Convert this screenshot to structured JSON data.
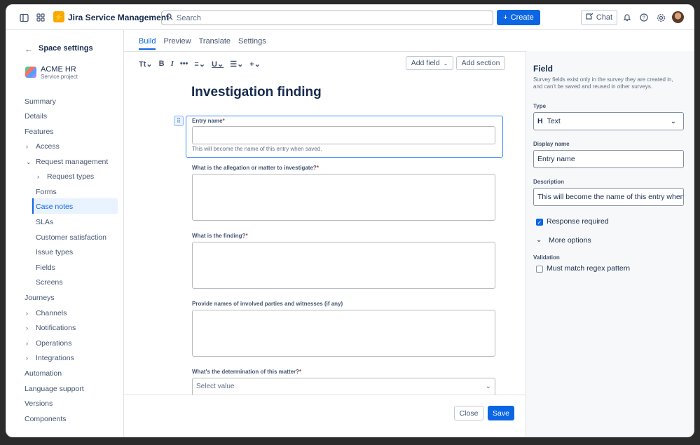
{
  "topbar": {
    "app_name": "Jira Service Management",
    "search_placeholder": "Search",
    "create_label": "Create",
    "chat_label": "Chat"
  },
  "sidebar": {
    "title": "Space settings",
    "project_name": "ACME HR",
    "project_type": "Service project",
    "items": [
      {
        "label": "Summary"
      },
      {
        "label": "Details"
      },
      {
        "label": "Features"
      },
      {
        "label": "Access"
      },
      {
        "label": "Request management"
      },
      {
        "label": "Request types"
      },
      {
        "label": "Forms"
      },
      {
        "label": "Case notes"
      },
      {
        "label": "SLAs"
      },
      {
        "label": "Customer satisfaction"
      },
      {
        "label": "Issue types"
      },
      {
        "label": "Fields"
      },
      {
        "label": "Screens"
      },
      {
        "label": "Journeys"
      },
      {
        "label": "Channels"
      },
      {
        "label": "Notifications"
      },
      {
        "label": "Operations"
      },
      {
        "label": "Integrations"
      },
      {
        "label": "Automation"
      },
      {
        "label": "Language support"
      },
      {
        "label": "Versions"
      },
      {
        "label": "Components"
      }
    ]
  },
  "tabs": [
    "Build",
    "Preview",
    "Translate",
    "Settings"
  ],
  "toolbar": {
    "add_field": "Add field",
    "add_section": "Add section"
  },
  "form": {
    "title": "Investigation finding",
    "fields": [
      {
        "label": "Entry name",
        "required": "*",
        "help": "This will become the name of this entry when saved."
      },
      {
        "label": "What is the allegation or matter to investigate?",
        "required": "*"
      },
      {
        "label": "What is the finding?",
        "required": "*"
      },
      {
        "label": "Provide names of involved parties and witnesses (if any)",
        "required": ""
      },
      {
        "label": "What's the determination of this matter?",
        "required": "*",
        "placeholder": "Select value"
      }
    ]
  },
  "footer": {
    "close": "Close",
    "save": "Save"
  },
  "panel": {
    "title": "Field",
    "description": "Survey fields exist only in the survey they are created in, and can't be saved and reused in other surveys.",
    "type_label": "Type",
    "type_value": "Text",
    "display_name_label": "Display name",
    "display_name_value": "Entry name",
    "description_label": "Description",
    "description_value": "This will become the name of this entry when saved.",
    "response_required": "Response required",
    "more_options": "More options",
    "validation_label": "Validation",
    "regex": "Must match regex pattern"
  },
  "colors": {
    "primary": "#0c66e4",
    "required": "#c9372c",
    "logo": "#fca700"
  }
}
